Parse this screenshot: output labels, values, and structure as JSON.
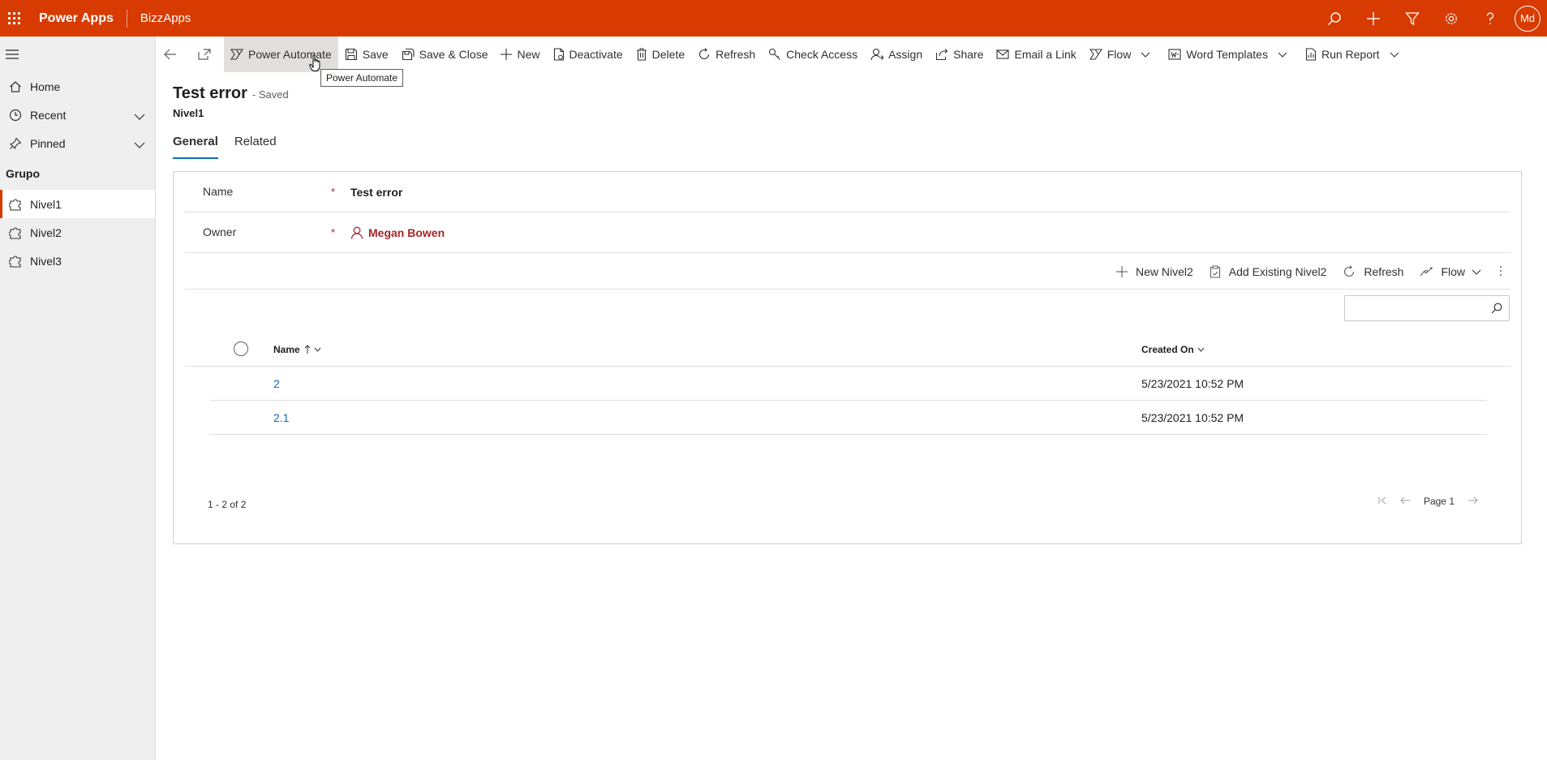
{
  "header": {
    "app_name": "Power Apps",
    "environment": "BizzApps",
    "avatar_initials": "Md",
    "icons": [
      "search-icon",
      "plus-icon",
      "filter-icon",
      "gear-icon",
      "help-icon"
    ]
  },
  "nav": {
    "items": [
      {
        "label": "Home",
        "icon": "home-icon"
      },
      {
        "label": "Recent",
        "icon": "clock-icon"
      },
      {
        "label": "Pinned",
        "icon": "pin-icon"
      }
    ],
    "group_label": "Grupo",
    "entities": [
      {
        "label": "Nivel1",
        "selected": true
      },
      {
        "label": "Nivel2",
        "selected": false
      },
      {
        "label": "Nivel3",
        "selected": false
      }
    ]
  },
  "commands": {
    "power_automate": "Power Automate",
    "save": "Save",
    "save_close": "Save & Close",
    "new": "New",
    "deactivate": "Deactivate",
    "delete": "Delete",
    "refresh": "Refresh",
    "check_access": "Check Access",
    "assign": "Assign",
    "share": "Share",
    "email_link": "Email a Link",
    "flow": "Flow",
    "word_templates": "Word Templates",
    "run_report": "Run Report",
    "tooltip": "Power Automate"
  },
  "record": {
    "title": "Test error",
    "status": "- Saved",
    "entity": "Nivel1"
  },
  "tabs": [
    "General",
    "Related"
  ],
  "form": {
    "name_label": "Name",
    "name_value": "Test error",
    "owner_label": "Owner",
    "owner_value": "Megan Bowen",
    "required_mark": "*"
  },
  "subgrid": {
    "commands": {
      "new": "New Nivel2",
      "add_existing": "Add Existing Nivel2",
      "refresh": "Refresh",
      "flow": "Flow"
    },
    "search_placeholder": "",
    "columns": {
      "name": "Name",
      "created_on": "Created On"
    },
    "rows": [
      {
        "name": "2",
        "created_on": "5/23/2021 10:52 PM"
      },
      {
        "name": "2.1",
        "created_on": "5/23/2021 10:52 PM"
      }
    ],
    "count_text": "1 - 2 of 2",
    "page_text": "Page 1"
  },
  "colors": {
    "brand": "#d83b01",
    "link": "#0f6cbd",
    "owner": "#a4262c"
  }
}
